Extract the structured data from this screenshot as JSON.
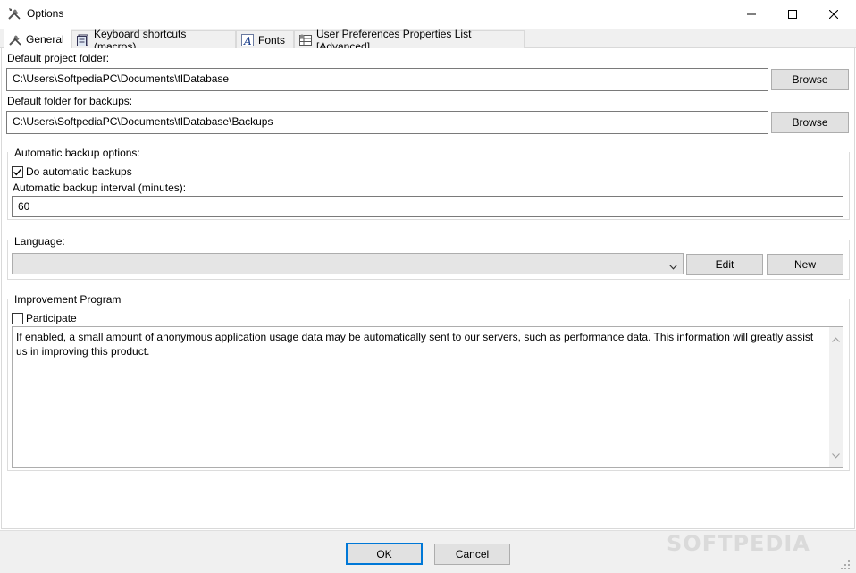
{
  "window": {
    "title": "Options",
    "app_icon": "tools-icon",
    "controls": {
      "minimize": "minimize-icon",
      "maximize": "maximize-icon",
      "close": "close-icon"
    }
  },
  "tabs": [
    {
      "label": "General",
      "icon": "tools-icon",
      "active": true
    },
    {
      "label": "Keyboard shortcuts (macros)",
      "icon": "keyboard-book-icon",
      "active": false
    },
    {
      "label": "Fonts",
      "icon": "font-icon",
      "active": false
    },
    {
      "label": "User Preferences Properties List [Advanced]",
      "icon": "property-grid-icon",
      "active": false
    }
  ],
  "general": {
    "project_folder": {
      "label": "Default project folder:",
      "value": "C:\\Users\\SoftpediaPC\\Documents\\tlDatabase",
      "browse_label": "Browse"
    },
    "backup_folder": {
      "label": "Default folder for backups:",
      "value": "C:\\Users\\SoftpediaPC\\Documents\\tlDatabase\\Backups",
      "browse_label": "Browse"
    },
    "auto_backup": {
      "group_label": "Automatic backup options:",
      "checkbox_label": "Do automatic backups",
      "checked": true,
      "interval_label": "Automatic backup interval (minutes):",
      "interval_value": "60"
    },
    "language": {
      "group_label": "Language:",
      "selected": "",
      "edit_label": "Edit",
      "new_label": "New"
    },
    "improvement": {
      "group_label": "Improvement Program",
      "checkbox_label": "Participate",
      "checked": false,
      "description": "If enabled, a small amount of anonymous application usage data may be automatically sent to our servers, such as performance data. This information will greatly assist us in improving this product."
    }
  },
  "footer": {
    "ok_label": "OK",
    "cancel_label": "Cancel"
  },
  "watermark": "SOFTPEDIA",
  "colors": {
    "accent": "#0078d7",
    "button_face": "#e1e1e1",
    "panel_bg": "#f0f0f0"
  }
}
